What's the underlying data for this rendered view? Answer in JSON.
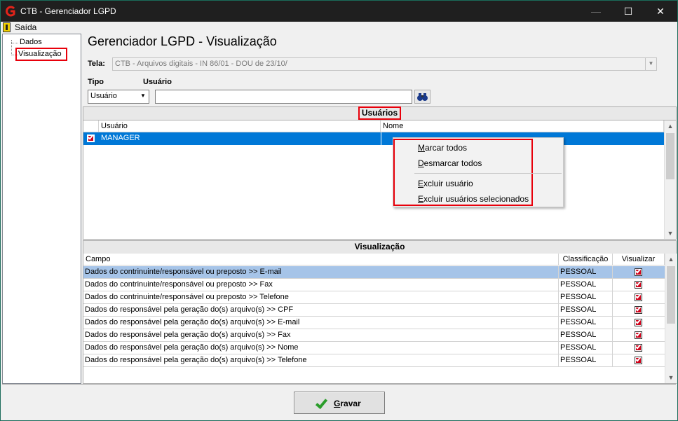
{
  "window": {
    "title": "CTB - Gerenciador LGPD",
    "minimize": "—",
    "maximize": "☐",
    "close": "✕"
  },
  "menu": {
    "exit_label": "Saída"
  },
  "tree": {
    "items": [
      "Dados",
      "Visualização"
    ]
  },
  "header": {
    "title": "Gerenciador LGPD - Visualização"
  },
  "tela": {
    "label": "Tela:",
    "value": "CTB - Arquivos digitais - IN 86/01 - DOU de 23/10/"
  },
  "filter": {
    "tipo_label": "Tipo",
    "tipo_value": "Usuário",
    "usuario_label": "Usuário",
    "usuario_value": ""
  },
  "users_panel": {
    "title": "Usuários",
    "columns": [
      "Usuário",
      "Nome"
    ],
    "rows": [
      {
        "usuario": "MANAGER",
        "nome": "",
        "checked": true
      }
    ]
  },
  "context_menu": {
    "items": [
      {
        "key": "M",
        "rest": "arcar todos"
      },
      {
        "key": "D",
        "rest": "esmarcar todos"
      },
      {
        "key": "E",
        "rest": "xcluir usuário"
      },
      {
        "key": "E",
        "rest": "xcluir usuários selecionados"
      }
    ]
  },
  "view_panel": {
    "title": "Visualização",
    "columns": [
      "Campo",
      "Classificação",
      "Visualizar"
    ],
    "rows": [
      {
        "campo": "Dados do contrinuinte/responsável ou preposto >> E-mail",
        "classificacao": "PESSOAL",
        "visualizar": true
      },
      {
        "campo": "Dados do contrinuinte/responsável ou preposto >> Fax",
        "classificacao": "PESSOAL",
        "visualizar": true
      },
      {
        "campo": "Dados do contrinuinte/responsável ou preposto >> Telefone",
        "classificacao": "PESSOAL",
        "visualizar": true
      },
      {
        "campo": "Dados do responsável pela geração do(s) arquivo(s) >> CPF",
        "classificacao": "PESSOAL",
        "visualizar": true
      },
      {
        "campo": "Dados do responsável pela geração do(s) arquivo(s) >> E-mail",
        "classificacao": "PESSOAL",
        "visualizar": true
      },
      {
        "campo": "Dados do responsável pela geração do(s) arquivo(s) >> Fax",
        "classificacao": "PESSOAL",
        "visualizar": true
      },
      {
        "campo": "Dados do responsável pela geração do(s) arquivo(s) >> Nome",
        "classificacao": "PESSOAL",
        "visualizar": true
      },
      {
        "campo": "Dados do responsável pela geração do(s) arquivo(s) >> Telefone",
        "classificacao": "PESSOAL",
        "visualizar": true
      }
    ]
  },
  "footer": {
    "save_key": "G",
    "save_rest": "ravar"
  },
  "colors": {
    "accent_red": "#e8000b",
    "selection": "#a6c4e8",
    "user_selection": "#0078d7",
    "check": "#d0021b"
  },
  "icons": [
    "app-logo-icon",
    "exit-door-icon",
    "binoculars-icon",
    "checkmark-icon"
  ]
}
